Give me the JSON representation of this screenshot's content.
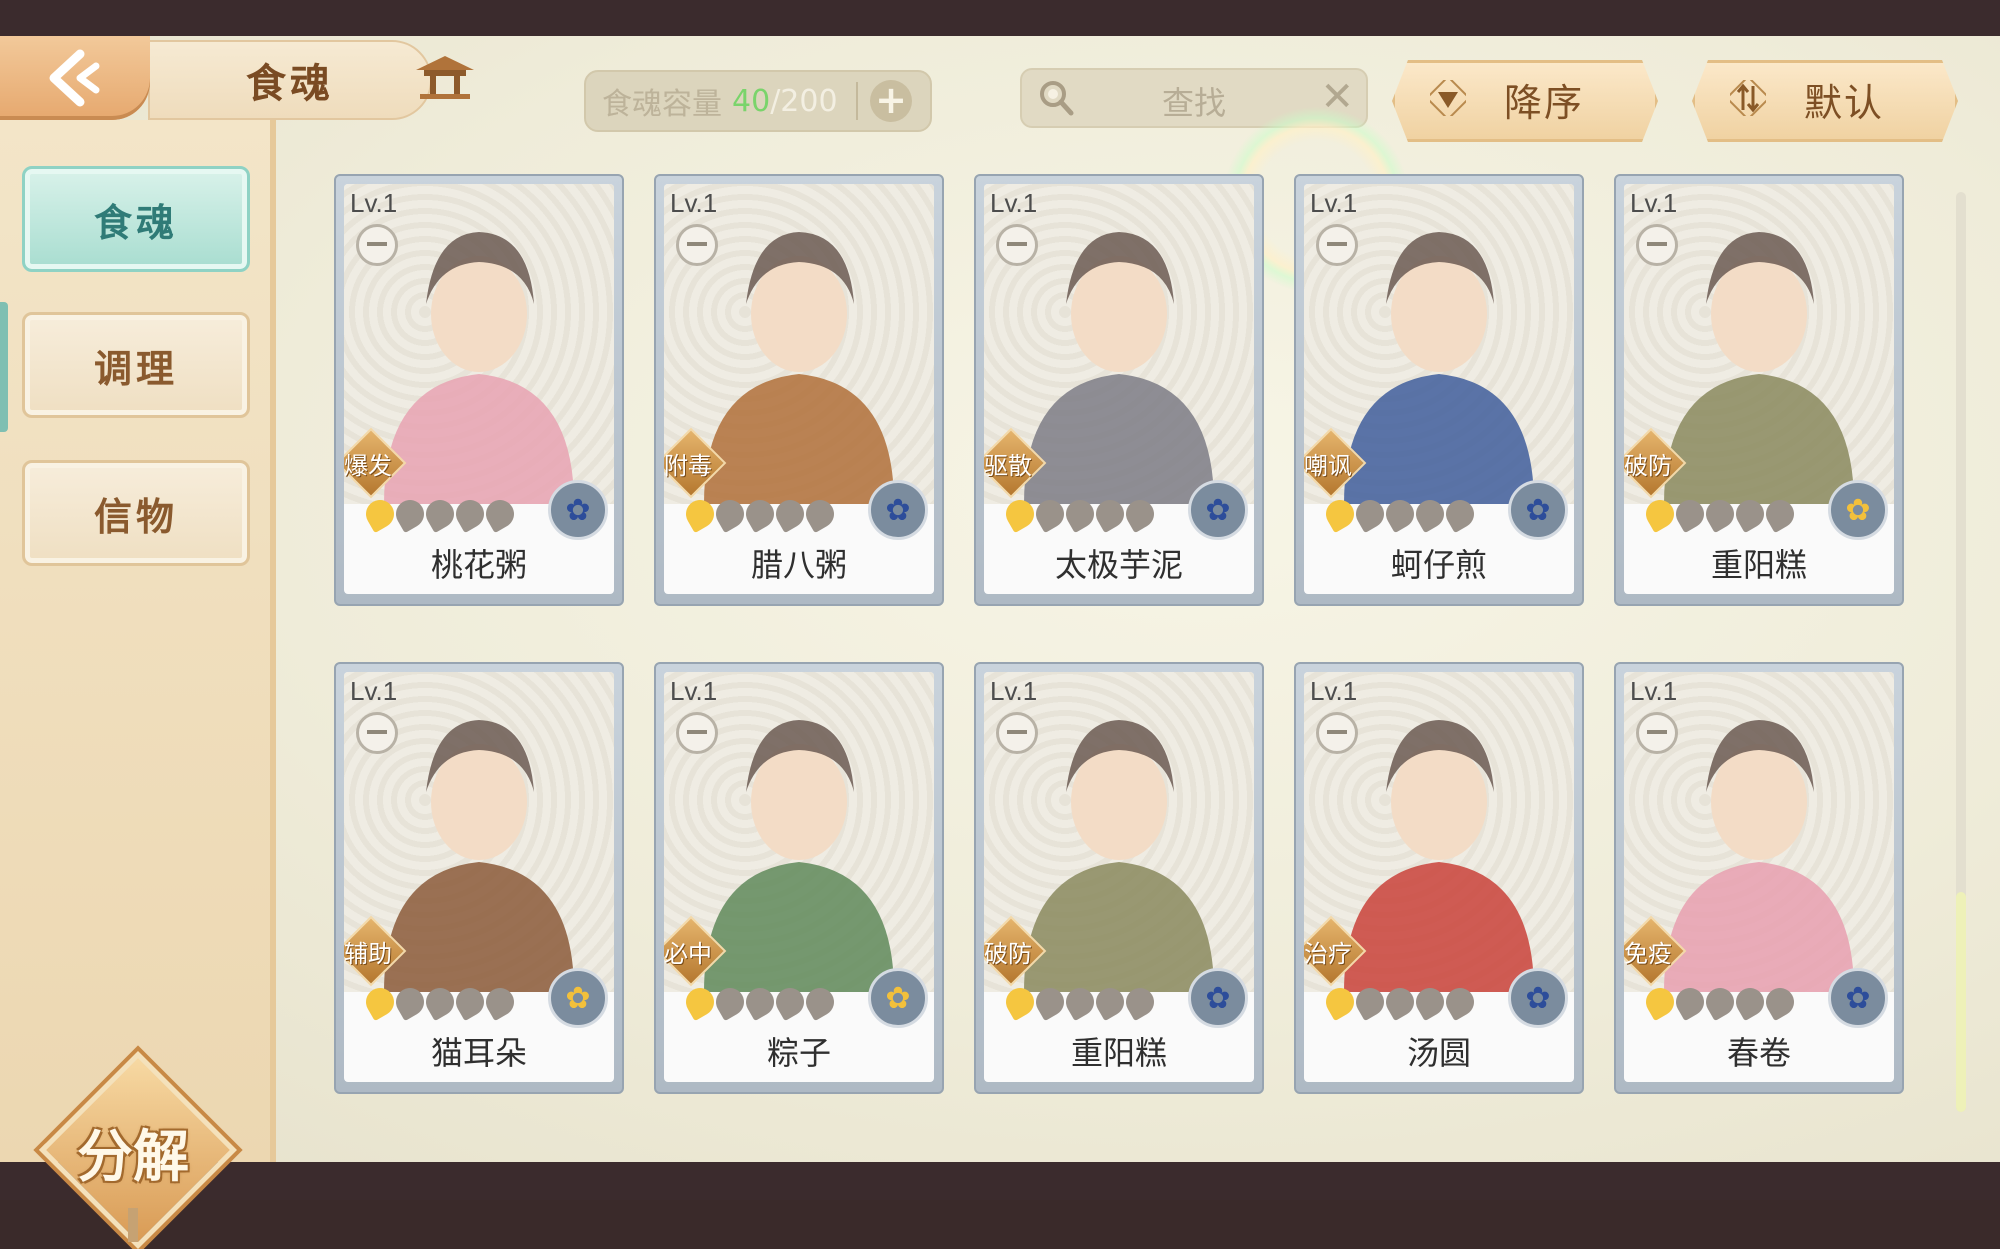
{
  "header": {
    "title": "食魂",
    "capacity": {
      "label": "食魂容量",
      "current": "40",
      "max": "/200"
    },
    "search": {
      "placeholder": "查找"
    },
    "sort_order": {
      "label": "降序"
    },
    "sort_mode": {
      "label": "默认"
    }
  },
  "sidebar": {
    "tabs": [
      {
        "label": "食魂",
        "active": true
      },
      {
        "label": "调理",
        "active": false
      },
      {
        "label": "信物",
        "active": false
      }
    ],
    "decompose_label": "分解"
  },
  "cards": [
    {
      "level": "Lv.1",
      "tag": "爆发",
      "name": "桃花粥",
      "stars": 1,
      "badge": "blue",
      "accent": "#e7a3b3"
    },
    {
      "level": "Lv.1",
      "tag": "附毒",
      "name": "腊八粥",
      "stars": 1,
      "badge": "blue",
      "accent": "#b0703a"
    },
    {
      "level": "Lv.1",
      "tag": "驱散",
      "name": "太极芋泥",
      "stars": 1,
      "badge": "blue",
      "accent": "#7c7c86"
    },
    {
      "level": "Lv.1",
      "tag": "嘲讽",
      "name": "蚵仔煎",
      "stars": 1,
      "badge": "blue",
      "accent": "#3f5e9c"
    },
    {
      "level": "Lv.1",
      "tag": "破防",
      "name": "重阳糕",
      "stars": 1,
      "badge": "gold",
      "accent": "#8a8a5e"
    },
    {
      "level": "Lv.1",
      "tag": "辅助",
      "name": "猫耳朵",
      "stars": 1,
      "badge": "gold",
      "accent": "#8b5a3a"
    },
    {
      "level": "Lv.1",
      "tag": "必中",
      "name": "粽子",
      "stars": 1,
      "badge": "gold",
      "accent": "#5f8a5a"
    },
    {
      "level": "Lv.1",
      "tag": "破防",
      "name": "重阳糕",
      "stars": 1,
      "badge": "blue",
      "accent": "#8a8a5e"
    },
    {
      "level": "Lv.1",
      "tag": "治疗",
      "name": "汤圆",
      "stars": 1,
      "badge": "blue",
      "accent": "#c9423a"
    },
    {
      "level": "Lv.1",
      "tag": "免疫",
      "name": "春卷",
      "stars": 1,
      "badge": "blue",
      "accent": "#e8a0b0"
    }
  ]
}
